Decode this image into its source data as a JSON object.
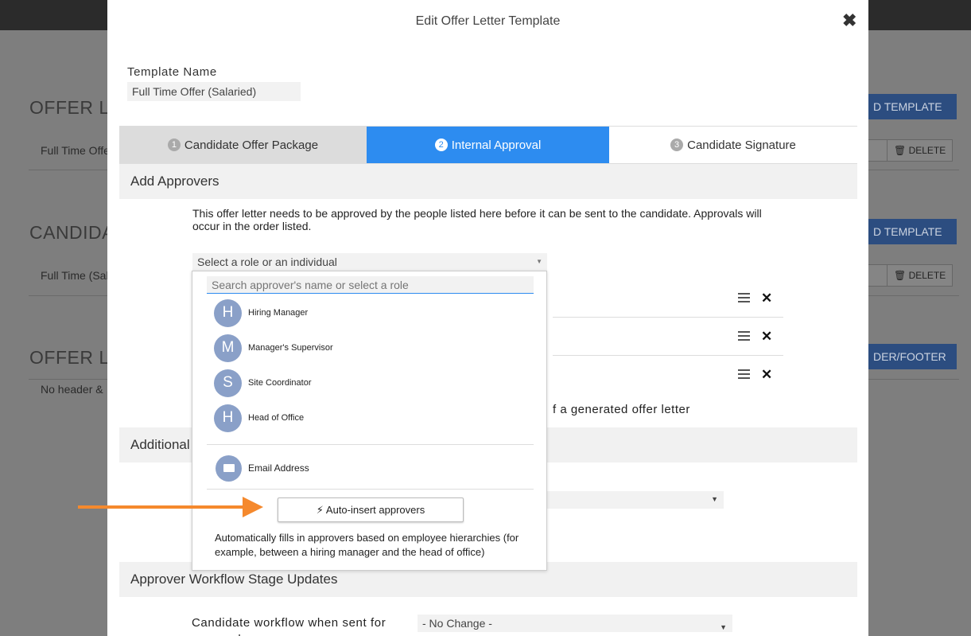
{
  "background": {
    "headings": [
      "OFFER LE",
      "CANDIDA",
      "OFFER LE"
    ],
    "rows": [
      "Full Time Offe",
      "Full Time (Sal",
      "No header &"
    ],
    "blue_buttons": [
      "D TEMPLATE",
      "D TEMPLATE",
      "DER/FOOTER"
    ],
    "delete_label": "DELETE"
  },
  "modal": {
    "title": "Edit Offer Letter Template",
    "template_name_label": "Template Name",
    "template_name_value": "Full Time Offer (Salaried)",
    "tabs": [
      {
        "num": "1",
        "label": "Candidate Offer Package"
      },
      {
        "num": "2",
        "label": "Internal Approval"
      },
      {
        "num": "3",
        "label": "Candidate Signature"
      }
    ],
    "add_approvers_heading": "Add Approvers",
    "description": "This offer letter needs to be approved by the people listed here before it can be sent to the candidate. Approvals will occur in the order listed.",
    "role_select_placeholder": "Select a role or an individual",
    "generated_text": "f a generated offer letter",
    "additional_heading": "Additional",
    "workflow_heading": "Approver Workflow Stage Updates",
    "candidate_workflow_label": "Candidate workflow when sent for approval",
    "candidate_workflow_value": "- No Change -"
  },
  "dropdown": {
    "search_placeholder": "Search approver's name or select a role",
    "items": [
      {
        "initial": "H",
        "label": "Hiring Manager"
      },
      {
        "initial": "M",
        "label": "Manager's Supervisor"
      },
      {
        "initial": "S",
        "label": "Site Coordinator"
      },
      {
        "initial": "H",
        "label": "Head of Office"
      }
    ],
    "email_label": "Email Address",
    "auto_insert_label": "Auto-insert approvers",
    "auto_insert_desc": "Automatically fills in approvers based on employee hierarchies (for example, between a hiring manager and the head of office)"
  },
  "colors": {
    "accent": "#2d8cf0",
    "avatar": "#8aa0c8",
    "arrow": "#f5892d"
  }
}
